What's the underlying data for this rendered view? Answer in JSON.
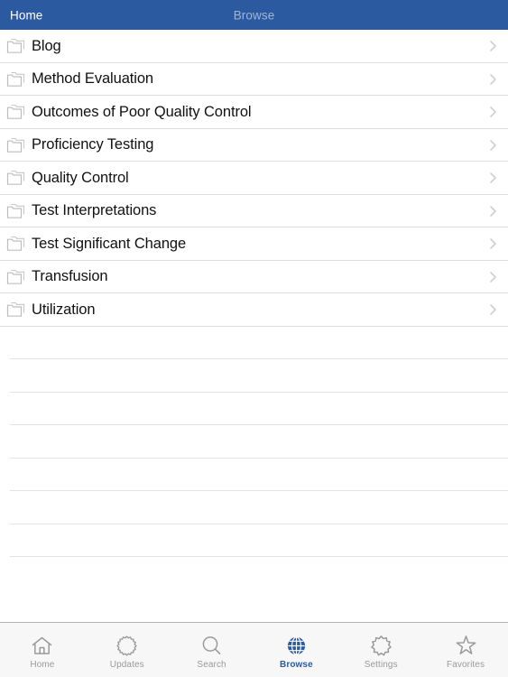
{
  "navbar": {
    "back_label": "Home",
    "title": "Browse",
    "background_color": "#2c5aa0",
    "back_color": "#ffffff",
    "title_color": "#9fb6d6"
  },
  "list": {
    "icon": "folder-icon",
    "accessory_icon": "chevron-right-icon",
    "separator_color": "#dedede",
    "items": [
      {
        "label": "Blog"
      },
      {
        "label": "Method Evaluation"
      },
      {
        "label": "Outcomes of Poor Quality Control"
      },
      {
        "label": "Proficiency Testing"
      },
      {
        "label": "Quality Control"
      },
      {
        "label": "Test Interpretations"
      },
      {
        "label": "Test Significant Change"
      },
      {
        "label": "Transfusion"
      },
      {
        "label": "Utilization"
      }
    ],
    "empty_row_count": 7
  },
  "tabbar": {
    "background_color": "#f7f7f7",
    "inactive_color": "#9a9a9a",
    "active_color": "#2c5aa0",
    "selected_index": 3,
    "tabs": [
      {
        "label": "Home",
        "icon": "house-icon"
      },
      {
        "label": "Updates",
        "icon": "cog-icon"
      },
      {
        "label": "Search",
        "icon": "magnifier-icon"
      },
      {
        "label": "Browse",
        "icon": "globe-icon"
      },
      {
        "label": "Settings",
        "icon": "gear-icon"
      },
      {
        "label": "Favorites",
        "icon": "star-icon"
      }
    ]
  }
}
